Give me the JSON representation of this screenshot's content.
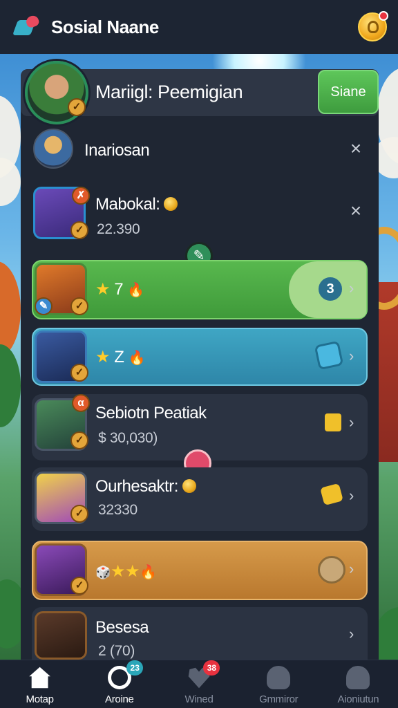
{
  "app": {
    "title": "Sosial Naane"
  },
  "header": {
    "name": "Mariigl: Peemigian",
    "action_label": "Siane"
  },
  "rows": [
    {
      "name": "Inariosan",
      "action": "×"
    },
    {
      "name": "Mabokal:",
      "value": "22.390",
      "action": "×"
    },
    {
      "stars_text": "7",
      "icon": "badge-3-icon"
    },
    {
      "stars_text": "Z",
      "icon": "tiles-icon"
    },
    {
      "name": "Sebiotn Peatiak",
      "value": "$ 30,030)"
    },
    {
      "name": "Ourhesaktr:",
      "value": "32330"
    },
    {
      "icon": "chat-icon"
    },
    {
      "name": "Besesa",
      "value": "2 (70)"
    }
  ],
  "bottom_nav": [
    {
      "label": "Motap",
      "icon": "home-icon",
      "active": true
    },
    {
      "label": "Aroine",
      "icon": "timer-icon",
      "badge": "23"
    },
    {
      "label": "Wined",
      "icon": "heart-icon",
      "badge": "38"
    },
    {
      "label": "Gmmiror",
      "icon": "bag-icon"
    },
    {
      "label": "Aioniutun",
      "icon": "profile-icon"
    }
  ],
  "colors": {
    "accent_green": "#4fae45",
    "accent_blue": "#3796ba",
    "accent_orange": "#c98a3c",
    "bg": "#1f2633"
  }
}
